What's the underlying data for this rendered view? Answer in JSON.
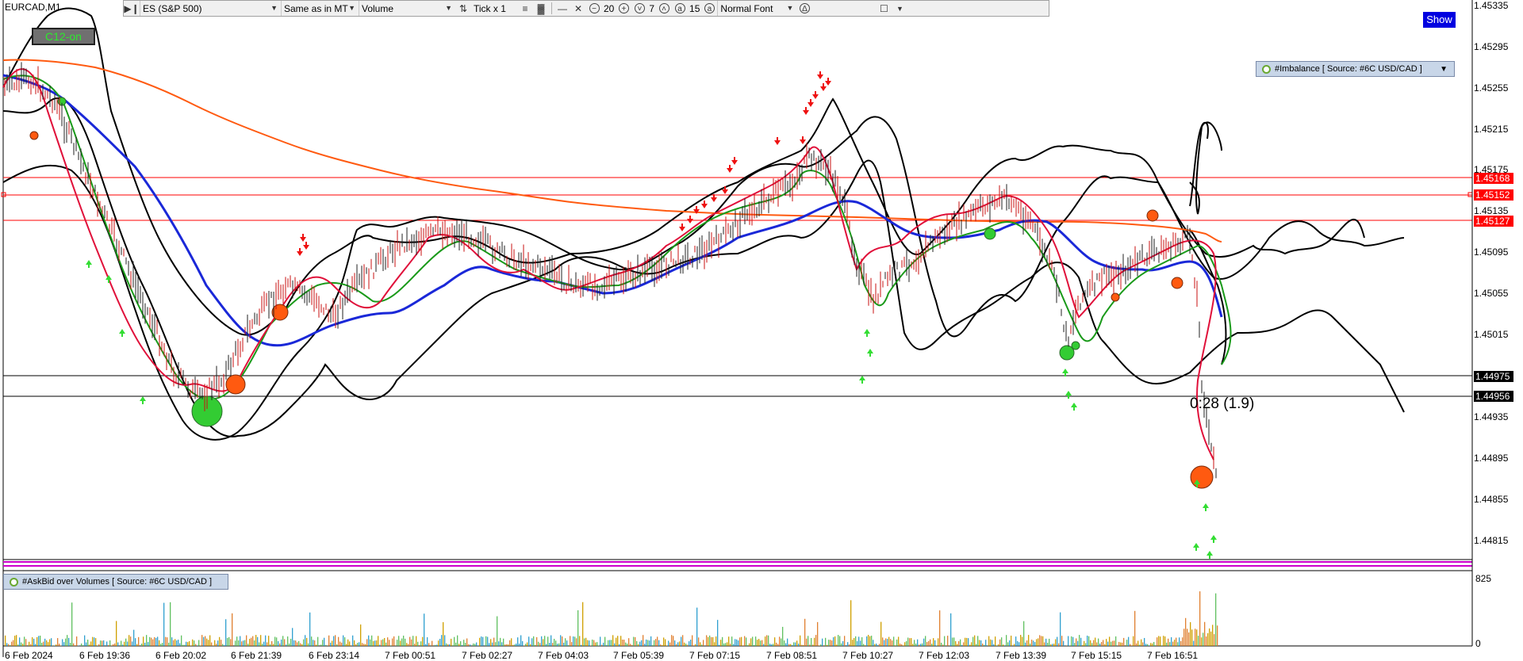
{
  "toolbar": {
    "instrument": "ES (S&P 500)",
    "time_mode": "Same as in MT",
    "data_type": "Volume",
    "tick_mode": "Tick x 1",
    "value_a": "20",
    "value_b": "7",
    "value_c": "15",
    "font_mode": "Normal Font"
  },
  "chart": {
    "symbol": "EURCAD,M1",
    "c12_label": "C12-on",
    "show_label": "Show",
    "imbalance_label": "#Imbalance [ Source: #6C USD/CAD ]",
    "askbid_label": "#AskBid over Volumes [ Source: #6C USD/CAD ]",
    "countdown": "0:28 (1.9)",
    "price_axis": [
      "1.45335",
      "1.45295",
      "1.45255",
      "1.45215",
      "1.45175",
      "1.45135",
      "1.45095",
      "1.45055",
      "1.45015",
      "1.44935",
      "1.44895",
      "1.44855",
      "1.44815"
    ],
    "price_tags_red": [
      "1.45168",
      "1.45152",
      "1.45127"
    ],
    "price_tags_black": [
      "1.44975",
      "1.44956"
    ],
    "volume_axis_max": "825",
    "volume_axis_min": "0",
    "time_labels": [
      "6 Feb 2024",
      "6 Feb 19:36",
      "6 Feb 20:02",
      "6 Feb 21:39",
      "6 Feb 23:14",
      "7 Feb 00:51",
      "7 Feb 02:27",
      "7 Feb 04:03",
      "7 Feb 05:39",
      "7 Feb 07:15",
      "7 Feb 08:51",
      "7 Feb 10:27",
      "7 Feb 12:03",
      "7 Feb 13:39",
      "7 Feb 15:15",
      "7 Feb 16:51"
    ],
    "colors": {
      "ma_blue": "#1a28d8",
      "ma_orange": "#ff5a10",
      "ma_green": "#1a9a1a",
      "ma_red": "#e0103a",
      "bands": "#000000",
      "arrow_up": "#33dd33",
      "arrow_down": "#ee1111",
      "level_red": "#ff0000",
      "level_black": "#000000",
      "dot_orange": "#ff5a10",
      "dot_green": "#33cc33",
      "strip_magenta": "#cc00cc"
    }
  }
}
